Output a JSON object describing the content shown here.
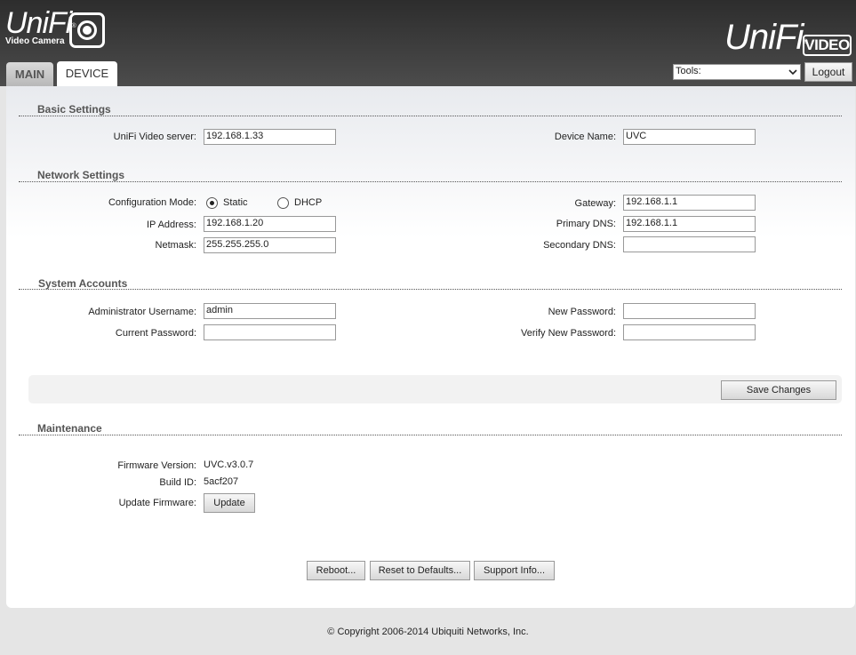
{
  "header": {
    "logo_left": {
      "word": "UniFi",
      "reg": "®",
      "subtitle": "Video Camera"
    },
    "logo_right": {
      "word": "UniFi",
      "reg": "®",
      "badge": "VIDEO"
    }
  },
  "tabs": [
    {
      "label": "MAIN",
      "active": false
    },
    {
      "label": "DEVICE",
      "active": true
    }
  ],
  "toolbar": {
    "tools_label": "Tools:",
    "logout_label": "Logout"
  },
  "basic_settings": {
    "title": "Basic Settings",
    "server_label": "UniFi Video server:",
    "server_value": "192.168.1.33",
    "device_name_label": "Device Name:",
    "device_name_value": "UVC"
  },
  "network_settings": {
    "title": "Network Settings",
    "config_mode_label": "Configuration Mode:",
    "mode_static": "Static",
    "mode_dhcp": "DHCP",
    "selected_mode": "Static",
    "ip_label": "IP Address:",
    "ip_value": "192.168.1.20",
    "netmask_label": "Netmask:",
    "netmask_value": "255.255.255.0",
    "gateway_label": "Gateway:",
    "gateway_value": "192.168.1.1",
    "primary_dns_label": "Primary DNS:",
    "primary_dns_value": "192.168.1.1",
    "secondary_dns_label": "Secondary DNS:",
    "secondary_dns_value": ""
  },
  "system_accounts": {
    "title": "System Accounts",
    "admin_username_label": "Administrator Username:",
    "admin_username_value": "admin",
    "current_password_label": "Current Password:",
    "current_password_value": "",
    "new_password_label": "New Password:",
    "new_password_value": "",
    "verify_password_label": "Verify New Password:",
    "verify_password_value": ""
  },
  "save_changes_label": "Save Changes",
  "maintenance": {
    "title": "Maintenance",
    "firmware_version_label": "Firmware Version:",
    "firmware_version_value": "UVC.v3.0.7",
    "build_id_label": "Build ID:",
    "build_id_value": "5acf207",
    "update_firmware_label": "Update Firmware:",
    "update_button": "Update"
  },
  "actions": {
    "reboot": "Reboot...",
    "reset_defaults": "Reset to Defaults...",
    "support_info": "Support Info..."
  },
  "footer": {
    "copyright": "© Copyright 2006-2014 Ubiquiti Networks, Inc."
  },
  "colors": {
    "header_bg": "#3a3a3a",
    "page_bg": "#e5e5e5",
    "panel_bg": "#ffffff"
  },
  "icons": {
    "camera": "camera-lens-icon",
    "dropdown": "chevron-down-icon"
  }
}
